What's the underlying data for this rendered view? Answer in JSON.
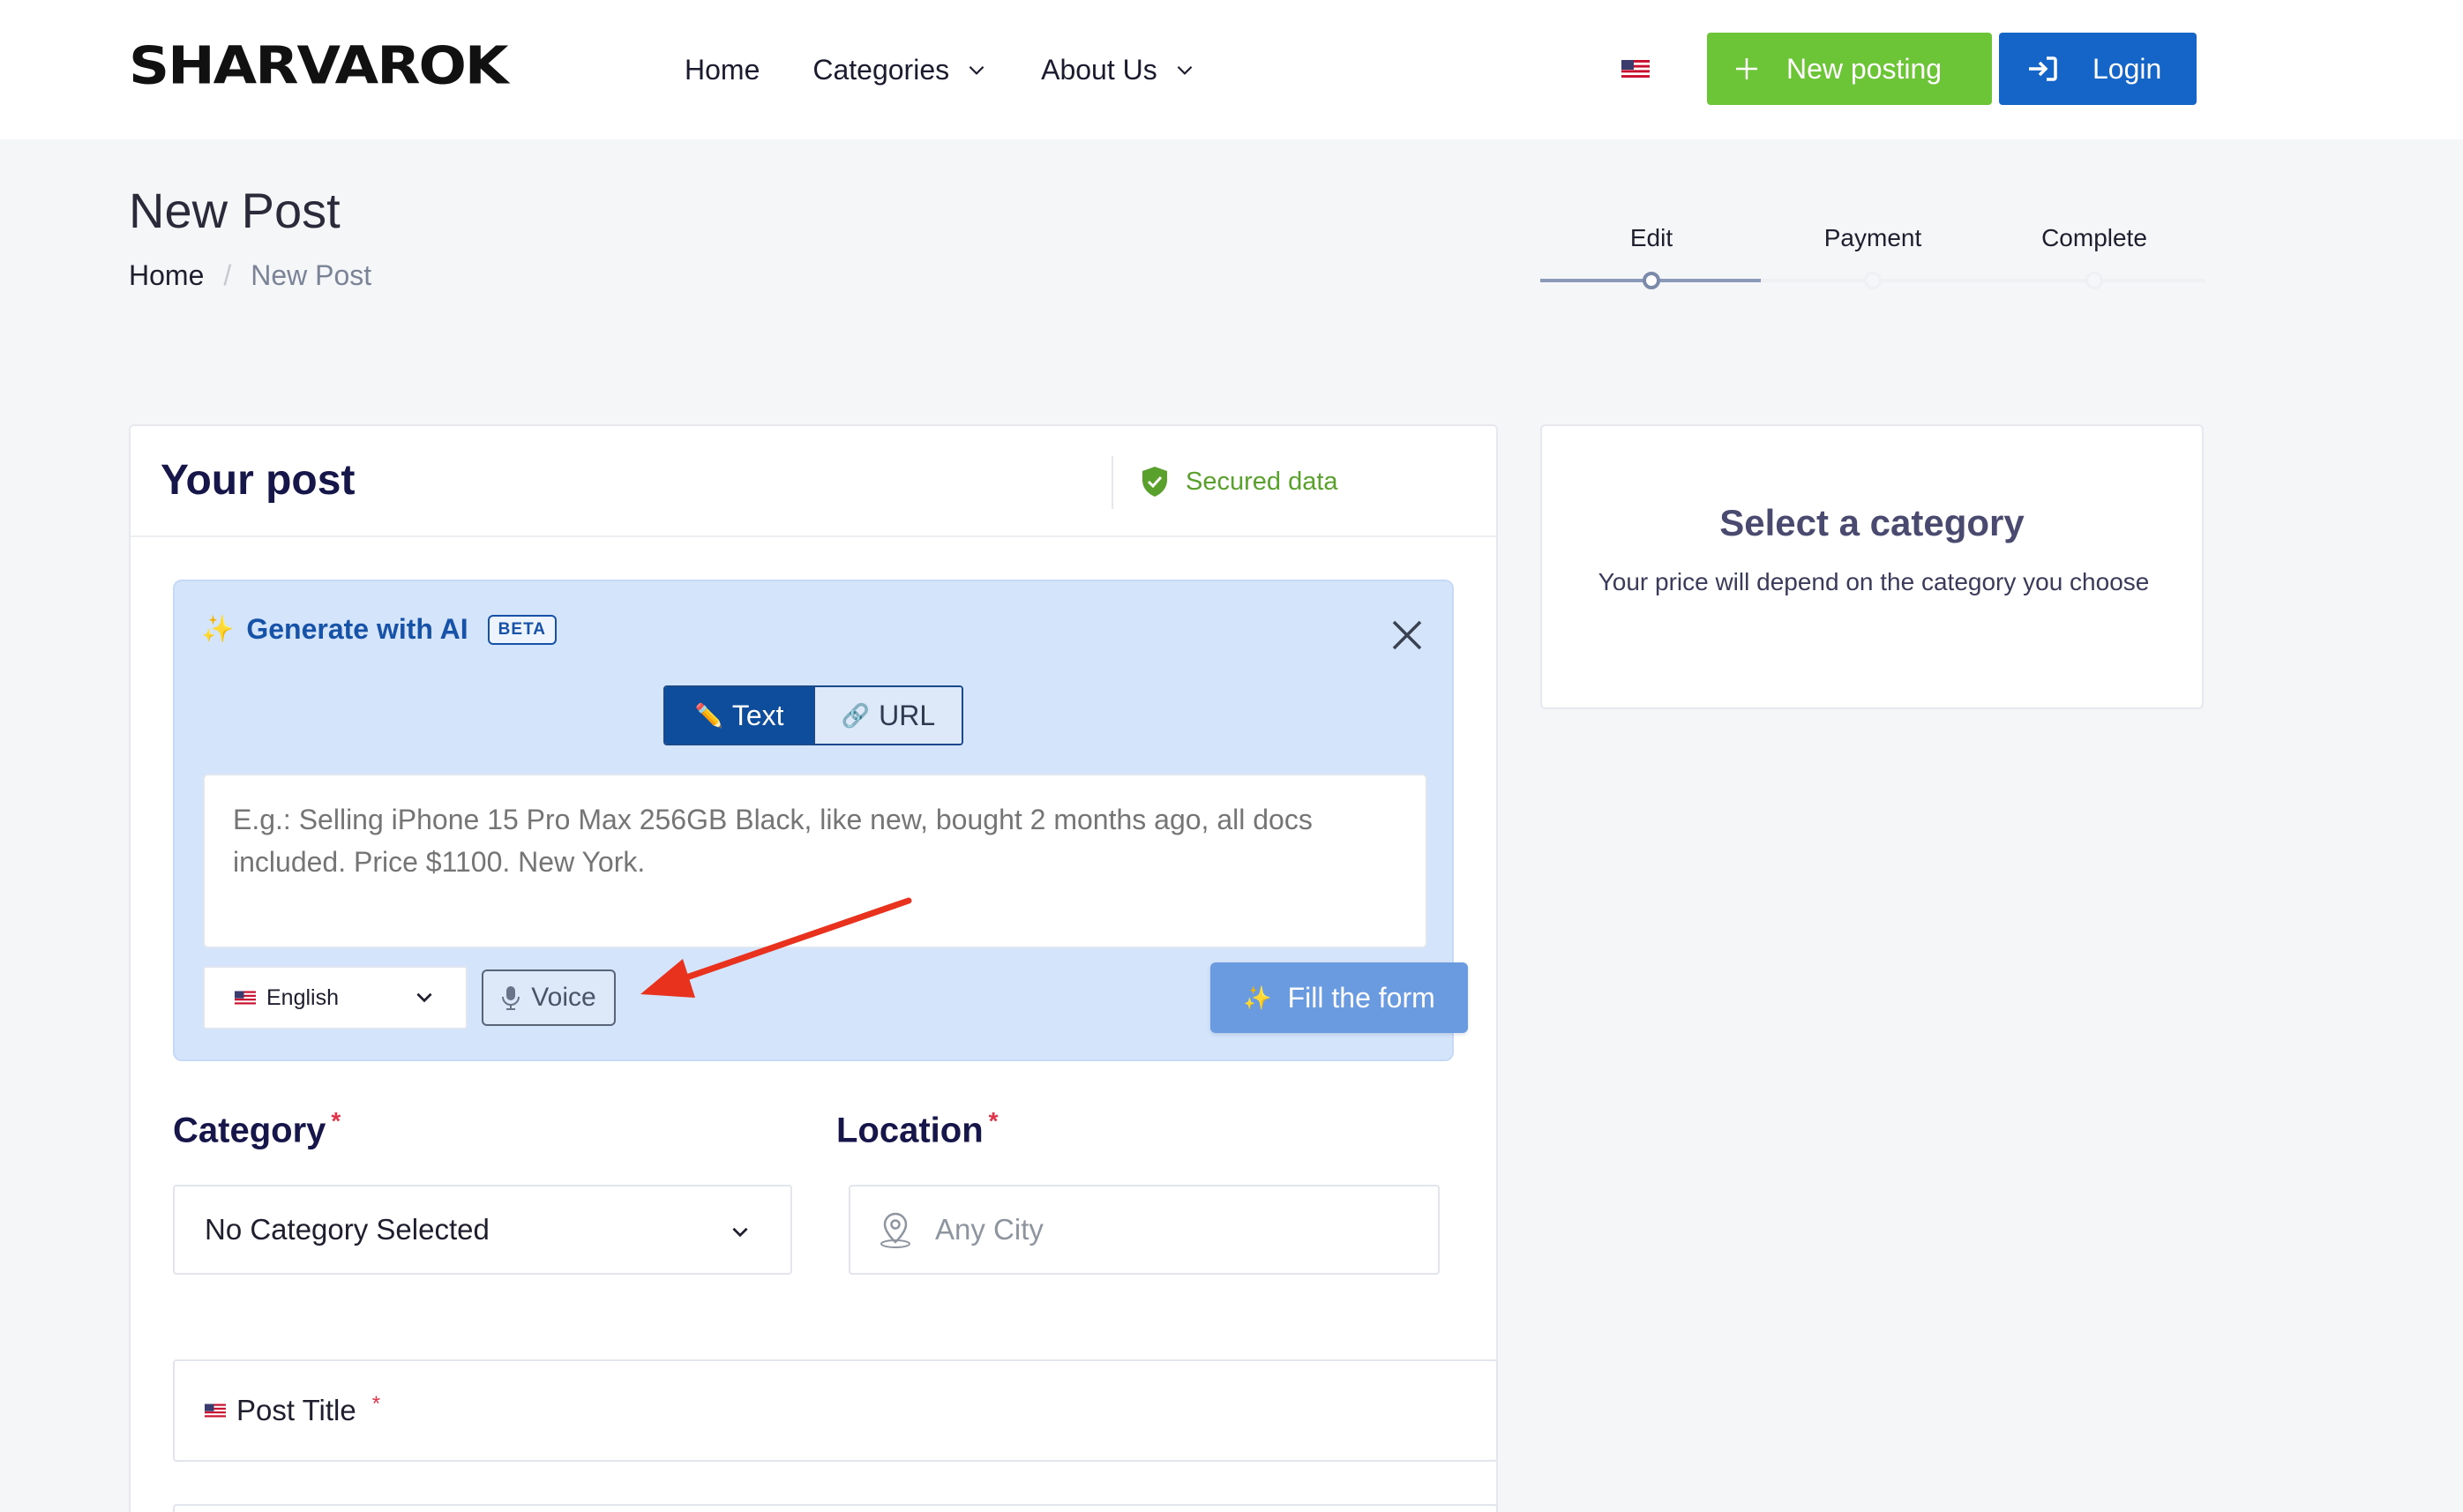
{
  "header": {
    "logo": "SHARVAROK",
    "nav": [
      {
        "label": "Home"
      },
      {
        "label": "Categories"
      },
      {
        "label": "About Us"
      }
    ],
    "new_posting": "New posting",
    "login": "Login"
  },
  "page": {
    "title": "New Post",
    "breadcrumb": {
      "home": "Home",
      "separator": "/",
      "current": "New Post"
    }
  },
  "steps": {
    "items": [
      {
        "label": "Edit"
      },
      {
        "label": "Payment"
      },
      {
        "label": "Complete"
      }
    ],
    "active_index": 0
  },
  "post_card": {
    "title": "Your post",
    "secured": "Secured data"
  },
  "ai_panel": {
    "title": "Generate with AI",
    "badge": "BETA",
    "sparkle": "✨",
    "tabs": {
      "text": "Text",
      "url": "URL"
    },
    "text_icon": "✏️",
    "url_icon": "🔗",
    "placeholder": "E.g.: Selling iPhone 15 Pro Max 256GB Black, like new, bought 2 months ago, all docs included. Price $1100. New York.",
    "language": "English",
    "voice": "Voice",
    "fill": "Fill the form"
  },
  "form": {
    "category_label": "Category",
    "category_value": "No Category Selected",
    "location_label": "Location",
    "location_placeholder": "Any City",
    "title_label": "Post Title",
    "required_mark": "*"
  },
  "side_card": {
    "title": "Select a category",
    "description": "Your price will depend on the category you choose"
  },
  "colors": {
    "green": "#6cc437",
    "blue": "#1565c8",
    "ai_bg": "#d4e4fb",
    "annotation_arrow": "#e8321e"
  }
}
